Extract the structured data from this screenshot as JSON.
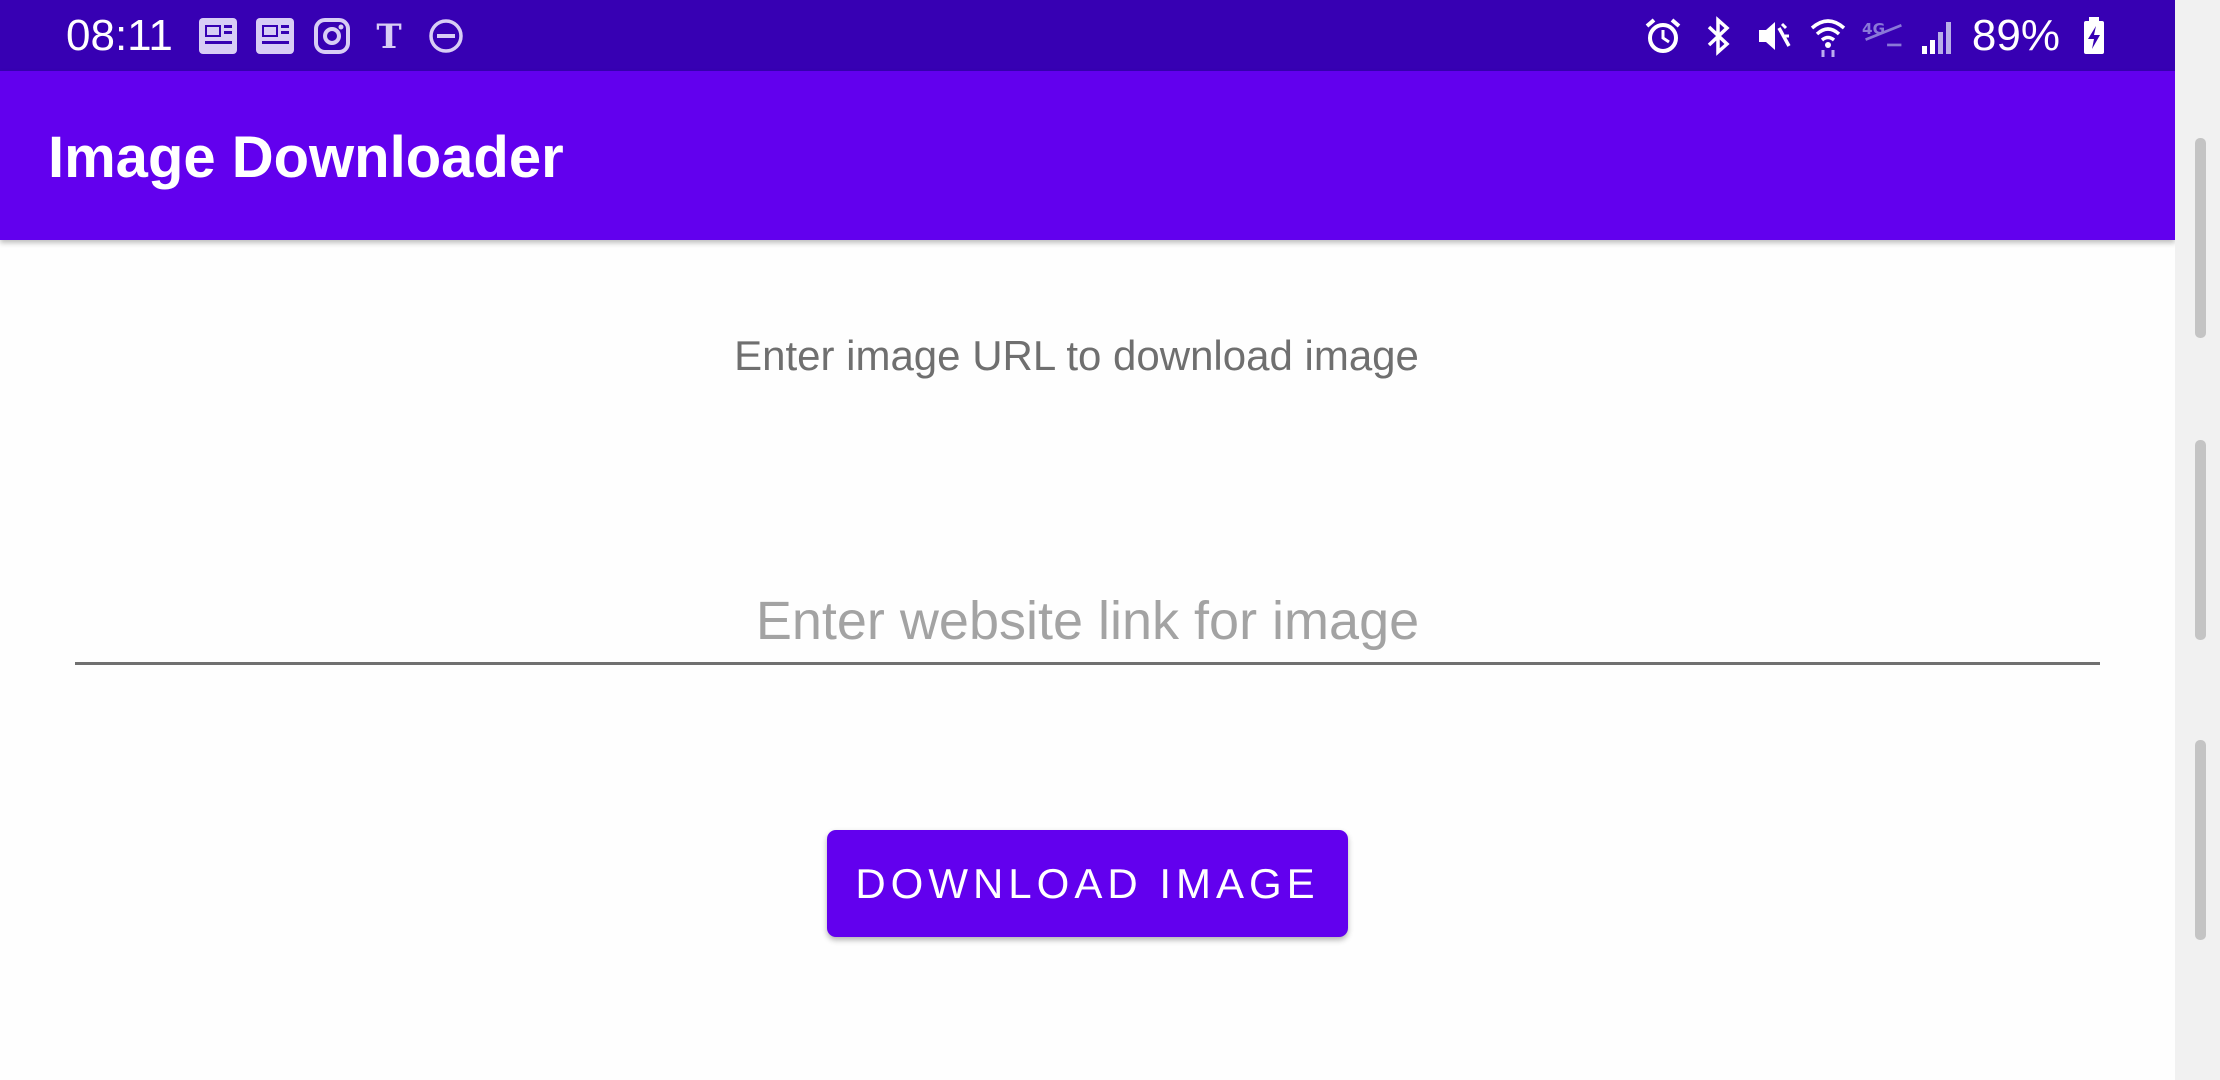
{
  "status_bar": {
    "time": "08:11",
    "battery": "89%",
    "left_icons": [
      "news-icon",
      "news-icon",
      "instagram-icon",
      "nyt-icon",
      "do-not-disturb-icon"
    ],
    "right_icons": [
      "alarm-icon",
      "bluetooth-icon",
      "vibrate-mute-icon",
      "wifi-icon",
      "lte-icon",
      "signal-icon",
      "battery-charging-icon"
    ]
  },
  "app_bar": {
    "title": "Image Downloader"
  },
  "main": {
    "prompt": "Enter image URL to download image",
    "url_input": {
      "value": "",
      "placeholder": "Enter website link for image"
    },
    "download_button_label": "DOWNLOAD IMAGE"
  },
  "colors": {
    "status_bar": "#3700b3",
    "primary": "#6200ee"
  }
}
